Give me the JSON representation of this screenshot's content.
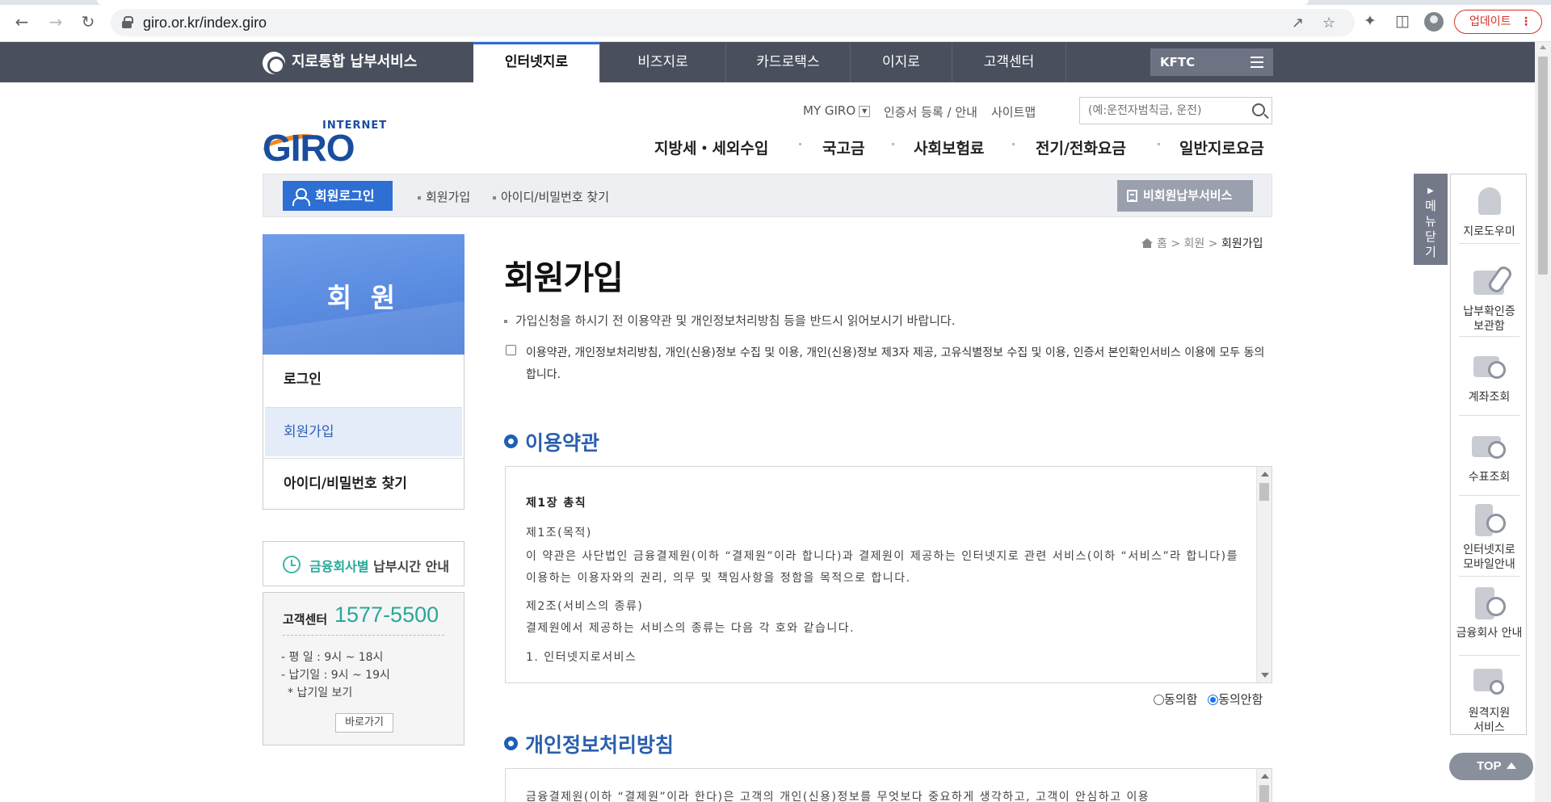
{
  "browser": {
    "url": "giro.or.kr/index.giro",
    "update_label": "업데이트"
  },
  "gnb": {
    "brand": "지로통합 납부서비스",
    "tabs": [
      "인터넷지로",
      "비즈지로",
      "카드로택스",
      "이지로",
      "고객센터"
    ],
    "kftc": "KFTC"
  },
  "util": {
    "mygiro": "MY GIRO",
    "cert": "인증서 등록 / 안내",
    "sitemap": "사이트맵",
    "search_placeholder": "(예:운전자범칙금, 운전)"
  },
  "logo": {
    "top": "INTERNET",
    "main": "GIRO"
  },
  "mainnav": [
    "지방세・세외수입",
    "국고금",
    "사회보험료",
    "전기/전화요금",
    "일반지로요금"
  ],
  "subbar": {
    "login": "회원로그인",
    "join": "회원가입",
    "find": "아이디/비밀번호 찾기",
    "nonmember": "비회원납부서비스"
  },
  "sidebar": {
    "title": "회 원",
    "items": [
      "로그인",
      "회원가입",
      "아이디/비밀번호 찾기"
    ],
    "paytime_hl": "금융회사별",
    "paytime_rest": " 납부시간 안내",
    "cs_label": "고객센터",
    "cs_number": "1577-5500",
    "weekday": "- 평   일 : 9시 ~ 18시",
    "dueday": "- 납기일 : 9시 ~ 19시",
    "duelink": "* 납기일 보기",
    "go": "바로가기"
  },
  "content": {
    "breadcrumb": [
      "홈",
      "회원",
      "회원가입"
    ],
    "title": "회원가입",
    "notice": "가입신청을 하시기 전 이용약관 및 개인정보처리방침 등을 반드시 읽어보시기 바랍니다.",
    "agree_all": "이용약관, 개인정보처리방침, 개인(신용)정보 수집 및 이용, 개인(신용)정보 제3자 제공, 고유식별정보 수집 및 이용, 인증서 본인확인서비스 이용에 모두 동의합니다.",
    "terms_title": "이용약관",
    "terms": {
      "chapter": "제1장 총칙",
      "a1_title": "제1조(목적)",
      "a1_body": "이 약관은 사단법인 금융결제원(이하 “결제원”이라 합니다)과 결제원이 제공하는 인터넷지로 관련 서비스(이하 “서비스”라 합니다)를 이용하는 이용자와의 권리, 의무 및 책임사항을 정함을 목적으로 합니다.",
      "a2_title": "제2조(서비스의 종류)",
      "a2_body": "결제원에서 제공하는 서비스의 종류는 다음 각 호와 같습니다.",
      "item1": "1. 인터넷지로서비스"
    },
    "agree": "동의함",
    "disagree": "동의안함",
    "privacy_title": "개인정보처리방침",
    "privacy_body": "금융결제원(이하 “결제원”이라 한다)은 고객의 개인(신용)정보를 무엇보다 중요하게 생각하고, 고객이 안심하고 이용"
  },
  "quick": {
    "toggle": "메뉴닫기",
    "items": [
      "지로도우미",
      "납부확인증\n보관함",
      "계좌조회",
      "수표조회",
      "인터넷지로\n모바일안내",
      "금융회사 안내",
      "원격지원\n서비스"
    ],
    "top": "TOP"
  }
}
